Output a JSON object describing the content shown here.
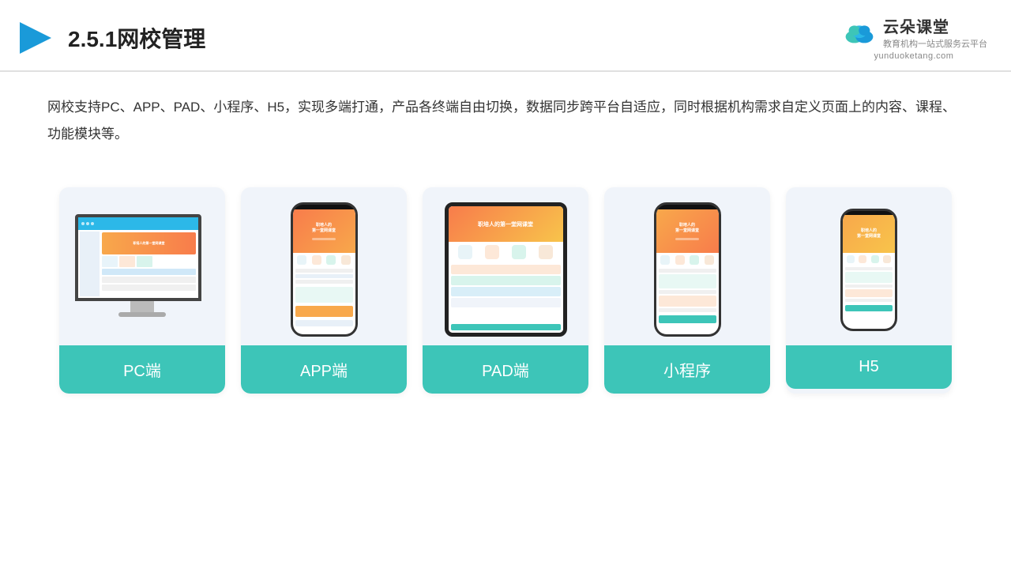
{
  "header": {
    "title": "2.5.1网校管理",
    "logo_main": "云朵课堂",
    "logo_url": "yunduoketang.com",
    "logo_slogan": "教育机构一站\n式服务云平台"
  },
  "description": {
    "text": "网校支持PC、APP、PAD、小程序、H5，实现多端打通，产品各终端自由切换，数据同步跨平台自适应，同时根据机构需求自定义页面上的内容、课程、功能模块等。"
  },
  "cards": [
    {
      "id": "pc",
      "label": "PC端"
    },
    {
      "id": "app",
      "label": "APP端"
    },
    {
      "id": "pad",
      "label": "PAD端"
    },
    {
      "id": "miniprogram",
      "label": "小程序"
    },
    {
      "id": "h5",
      "label": "H5"
    }
  ],
  "accent_color": "#3dc5b8"
}
